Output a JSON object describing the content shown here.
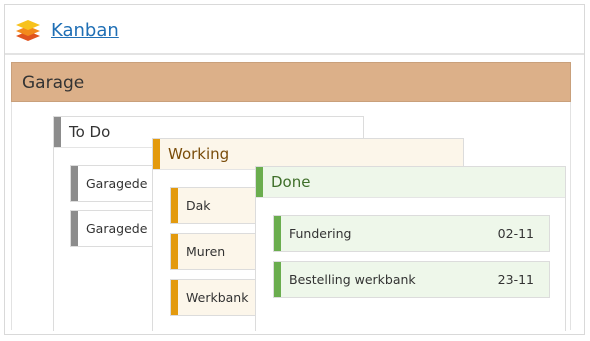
{
  "app": {
    "title": "Kanban"
  },
  "board": {
    "name": "Garage"
  },
  "columns": [
    {
      "title": "To Do",
      "color": "#8c8c8c",
      "cards": [
        {
          "label": "Garagede"
        },
        {
          "label": "Garagede"
        }
      ]
    },
    {
      "title": "Working",
      "color": "#e39a0e",
      "cards": [
        {
          "label": "Dak"
        },
        {
          "label": "Muren"
        },
        {
          "label": "Werkbank"
        }
      ]
    },
    {
      "title": "Done",
      "color": "#6aad4e",
      "cards": [
        {
          "label": "Fundering",
          "date": "02-11"
        },
        {
          "label": "Bestelling werkbank",
          "date": "23-11"
        }
      ]
    }
  ],
  "colors": {
    "board_header": "#dcb089",
    "working_bg": "#fcf6ea",
    "done_bg": "#eef7ea",
    "link": "#1f6fb5"
  }
}
